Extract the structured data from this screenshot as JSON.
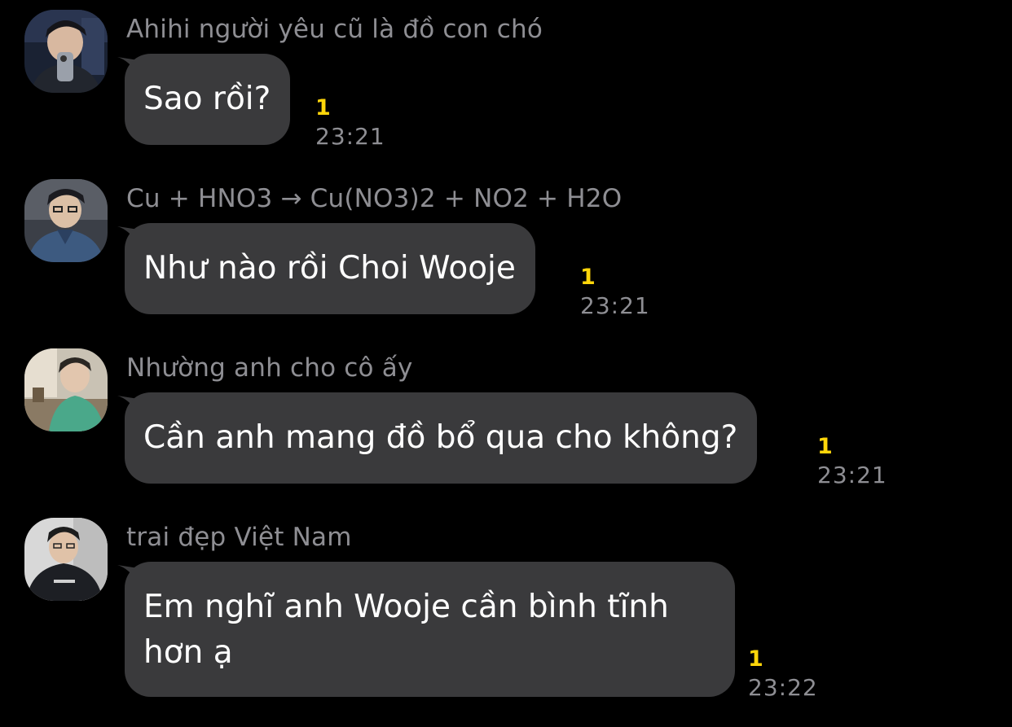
{
  "messages": [
    {
      "sender": "Ahihi người yêu cũ là đồ con chó",
      "text": "Sao rồi?",
      "unread": "1",
      "time": "23:21",
      "avatar": "profile-photo"
    },
    {
      "sender": "Cu + HNO3 → Cu(NO3)2 + NO2 + H2O",
      "text": "Như nào rồi Choi Wooje",
      "unread": "1",
      "time": "23:21",
      "avatar": "profile-photo"
    },
    {
      "sender": "Nhường anh cho cô ấy",
      "text": "Cần anh mang đồ bổ qua cho không?",
      "unread": "1",
      "time": "23:21",
      "avatar": "profile-photo"
    },
    {
      "sender": "trai đẹp Việt Nam",
      "text": "Em nghĩ anh Wooje cần bình tĩnh hơn ạ",
      "unread": "1",
      "time": "23:22",
      "avatar": "profile-photo"
    }
  ],
  "colors": {
    "background": "#000000",
    "bubble": "#3a3a3c",
    "sender": "#8e8e93",
    "unread": "#ffd60a",
    "time": "#8e8e93"
  }
}
